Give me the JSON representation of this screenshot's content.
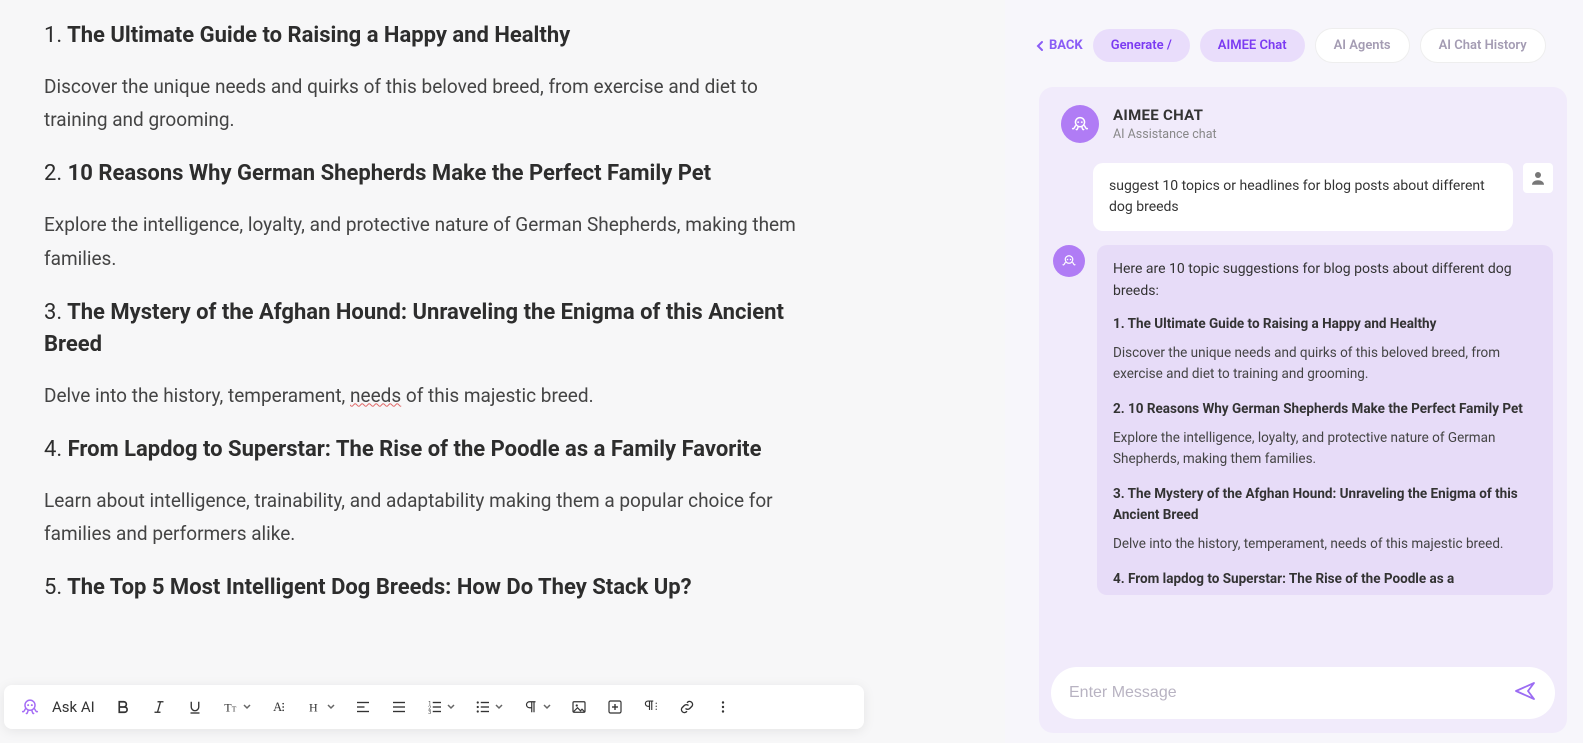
{
  "document": {
    "items": [
      {
        "num": "1.",
        "title": "The Ultimate Guide to Raising a Happy and Healthy",
        "desc": "Discover the unique needs and quirks of this beloved breed, from exercise and diet to training and grooming."
      },
      {
        "num": "2.",
        "title": "10 Reasons Why German Shepherds Make the Perfect Family Pet",
        "desc": "Explore the intelligence, loyalty, and protective nature of German Shepherds, making them families."
      },
      {
        "num": "3.",
        "title": "The Mystery of the Afghan Hound: Unraveling the Enigma of this Ancient Breed",
        "desc_pre": "Delve into the history, temperament, ",
        "desc_err": "needs",
        "desc_post": " of this majestic breed."
      },
      {
        "num": "4.",
        "title": "From Lapdog to Superstar: The Rise of the Poodle as a Family Favorite",
        "desc": "Learn about intelligence, trainability, and adaptability making them a popular choice for families and performers alike."
      },
      {
        "num": "5.",
        "title": "The Top 5 Most Intelligent Dog Breeds: How Do They Stack Up?",
        "desc": ""
      }
    ]
  },
  "toolbar": {
    "ask_ai": "Ask AI"
  },
  "panel": {
    "back": "BACK",
    "tabs": {
      "generate": "Generate /",
      "aimee": "AIMEE Chat",
      "agents": "AI Agents",
      "history": "AI Chat History"
    },
    "chat_header": {
      "title": "AIMEE CHAT",
      "subtitle": "AI Assistance chat"
    },
    "user_msg": "suggest 10 topics or headlines for blog posts about different dog breeds",
    "ai": {
      "intro": "Here are 10 topic suggestions for blog posts about different dog breeds:",
      "items": [
        {
          "title": "1. The Ultimate Guide to Raising a Happy and Healthy",
          "desc": "Discover the unique needs and quirks of this beloved breed, from exercise and diet to training and grooming."
        },
        {
          "title": "2. 10 Reasons Why German Shepherds Make the Perfect Family Pet",
          "desc": "Explore the intelligence, loyalty, and protective nature of German Shepherds, making them families."
        },
        {
          "title": "3. The Mystery of the Afghan Hound: Unraveling the Enigma of this Ancient Breed",
          "desc": "Delve into the history, temperament, needs of this majestic breed."
        },
        {
          "title": "4. From lapdog to Superstar: The Rise of the Poodle as a",
          "desc": ""
        }
      ]
    },
    "input_placeholder": "Enter Message"
  }
}
